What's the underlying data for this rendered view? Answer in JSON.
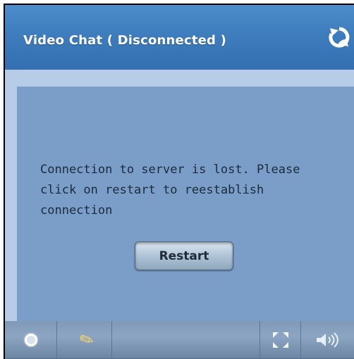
{
  "window": {
    "title": "Video Chat ( Disconnected )"
  },
  "main": {
    "message": "Connection to server is lost. Please click on restart to reestablish connection",
    "restart_label": "Restart"
  },
  "toolbar": {
    "items": [
      {
        "icon": "settings-icon"
      },
      {
        "icon": "microphone-icon"
      },
      {
        "icon": "fullscreen-icon"
      },
      {
        "icon": "volume-icon"
      }
    ]
  },
  "colors": {
    "title_bar": "#3f7ebf",
    "content_bg": "#7b9ec9",
    "panel_bg": "#b7cde7",
    "toolbar_bg": "#7f99b8"
  }
}
